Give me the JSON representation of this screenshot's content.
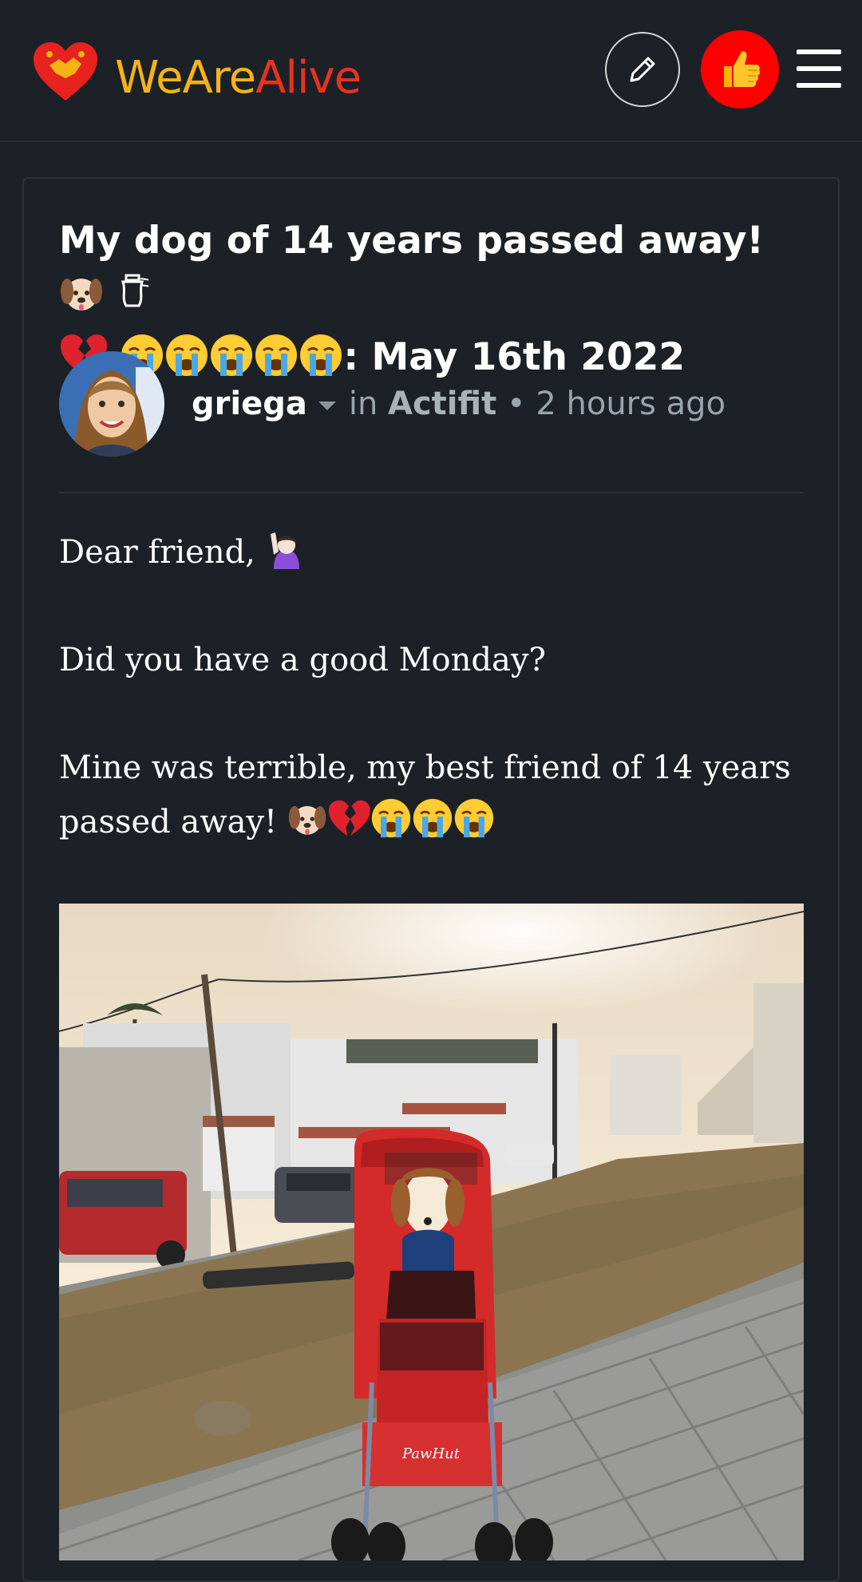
{
  "header": {
    "logo_we": "We",
    "logo_are": "Are",
    "logo_alive": "Alive",
    "edit_icon": "pencil-icon",
    "like_icon": "thumbs-up-icon",
    "menu_icon": "hamburger-menu-icon",
    "colors": {
      "we": "#f5b316",
      "alive": "#e8331e",
      "like_bg": "#ff0000"
    }
  },
  "post": {
    "title": "My dog of 14 years passed away!",
    "title_suffix": ": May 16th 2022",
    "author": "griega",
    "in_label": "in",
    "community": "Actifit",
    "separator": "•",
    "time_ago": "2 hours ago",
    "paragraphs": [
      "Dear friend,",
      "Did you have a good Monday?",
      "Mine was terrible, my best friend of 14 years passed away!"
    ],
    "photo": {
      "stroller_brand": "PawHut"
    }
  }
}
